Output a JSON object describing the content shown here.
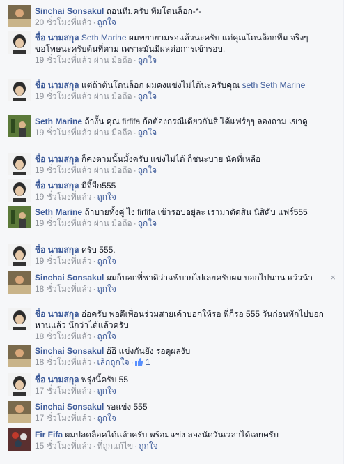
{
  "comments": [
    {
      "author": "Sinchai Sonsakul",
      "mention": "",
      "text": "ถอนทีมครับ ทีมโดนล็อก-*-",
      "time": "20 ชั่วโมงที่แล้ว",
      "via": "",
      "like": "ถูกใจ",
      "likes": ""
    },
    {
      "author": "ชื่อ นามสกุล",
      "mention": "Seth Marine",
      "text": "ผมพยายามรอแล้วนะครับ แต่คุณโดนล็อกทีม จริงๆ",
      "text2": "ขอโทษนะครับต้นที่ตาม เพราะมันมีผลต่อการเข้ารอบ.",
      "time": "19 ชั่วโมงที่แล้ว",
      "via": "ผ่าน มือถือ",
      "like": "ถูกใจ",
      "likes": ""
    },
    {
      "author": "ชื่อ นามสกุล",
      "mention": "",
      "text": "แต่ถ้าต้นโดนล็อก ผมคงแข่งไม่ได้นะครับคุณ",
      "mention_after": "seth Seth Marine",
      "time": "19 ชั่วโมงที่แล้ว",
      "via": "ผ่าน มือถือ",
      "like": "ถูกใจ",
      "likes": ""
    },
    {
      "author": "Seth Marine",
      "mention": "",
      "text": "ถ้างั้น คุณ firfifa ก้อต้องกรณีเดียวกันสิ ได้แฟร์ๆๆ ลองถาม เขาดู",
      "time": "19 ชั่วโมงที่แล้ว",
      "via": "ผ่าน มือถือ",
      "like": "ถูกใจ",
      "likes": ""
    },
    {
      "author": "ชื่อ นามสกุล",
      "mention": "",
      "text": "ก็คงตามนั้นมั้งครับ แข่งไม่ได้ ก็ชนะบาย นัดที่เหลือ",
      "time": "19 ชั่วโมงที่แล้ว",
      "via": "ผ่าน มือถือ",
      "like": "ถูกใจ",
      "likes": ""
    },
    {
      "author": "ชื่อ นามสกุล",
      "mention": "",
      "text": "มีจี้อีก555",
      "time": "19 ชั่วโมงที่แล้ว",
      "via": "",
      "like": "ถูกใจ",
      "likes": ""
    },
    {
      "author": "Seth Marine",
      "mention": "",
      "text": "ถ้าบายทั้งคู่ ไง firfifa เข้ารอบอยู่ละ เรามาตัดสิน นี่สิคับ แฟร์555",
      "time": "19 ชั่วโมงที่แล้ว",
      "via": "ผ่าน มือถือ",
      "like": "ถูกใจ",
      "likes": ""
    },
    {
      "author": "ชื่อ นามสกุล",
      "mention": "",
      "text": "ครับ 555.",
      "time": "19 ชั่วโมงที่แล้ว",
      "via": "",
      "like": "ถูกใจ",
      "likes": ""
    },
    {
      "author": "Sinchai Sonsakul",
      "mention": "",
      "text": "ผมก็บอกพี่ซาดิว่าแพ้บายไปเลยครับผม บอกไปนาน แว้วน้า",
      "time": "18 ชั่วโมงที่แล้ว",
      "via": "",
      "like": "ถูกใจ",
      "likes": ""
    },
    {
      "author": "ชื่อ นามสกุล",
      "mention": "",
      "text": "อ่อครับ พอดีเพื่อนร่วมสายเค้าบอกให้รอ พี่ก็รอ 555 วันก่อนทักไปบอกหานแล้ว นึกว่าได้แล้วครับ",
      "time": "18 ชั่วโมงที่แล้ว",
      "via": "",
      "like": "ถูกใจ",
      "likes": ""
    },
    {
      "author": "Sinchai Sonsakul",
      "mention": "",
      "text": "อ๊อิ แข่งกันยัง รอดูผลงับ",
      "time": "18 ชั่วโมงที่แล้ว",
      "via": "",
      "like": "เลิกถูกใจ",
      "likes": "1"
    },
    {
      "author": "ชื่อ นามสกุล",
      "mention": "",
      "text": "พรุ่งนี้ครับ 55",
      "time": "17 ชั่วโมงที่แล้ว",
      "via": "",
      "like": "ถูกใจ",
      "likes": ""
    },
    {
      "author": "Sinchai Sonsakul",
      "mention": "",
      "text": "รอแข่ง 555",
      "time": "17 ชั่วโมงที่แล้ว",
      "via": "",
      "like": "ถูกใจ",
      "likes": ""
    },
    {
      "author": "Fir Fifa",
      "mention": "",
      "text": "ผมปลดล็อคได้แล้วครับ พร้อมแข่ง ลองนัดวันเวลาได้เลยครับ",
      "time": "15 ชั่วโมงที่แล้ว",
      "via": "ที่ถูกแก้ไข",
      "like": "ถูกใจ",
      "likes": ""
    }
  ],
  "close_glyph": "×"
}
